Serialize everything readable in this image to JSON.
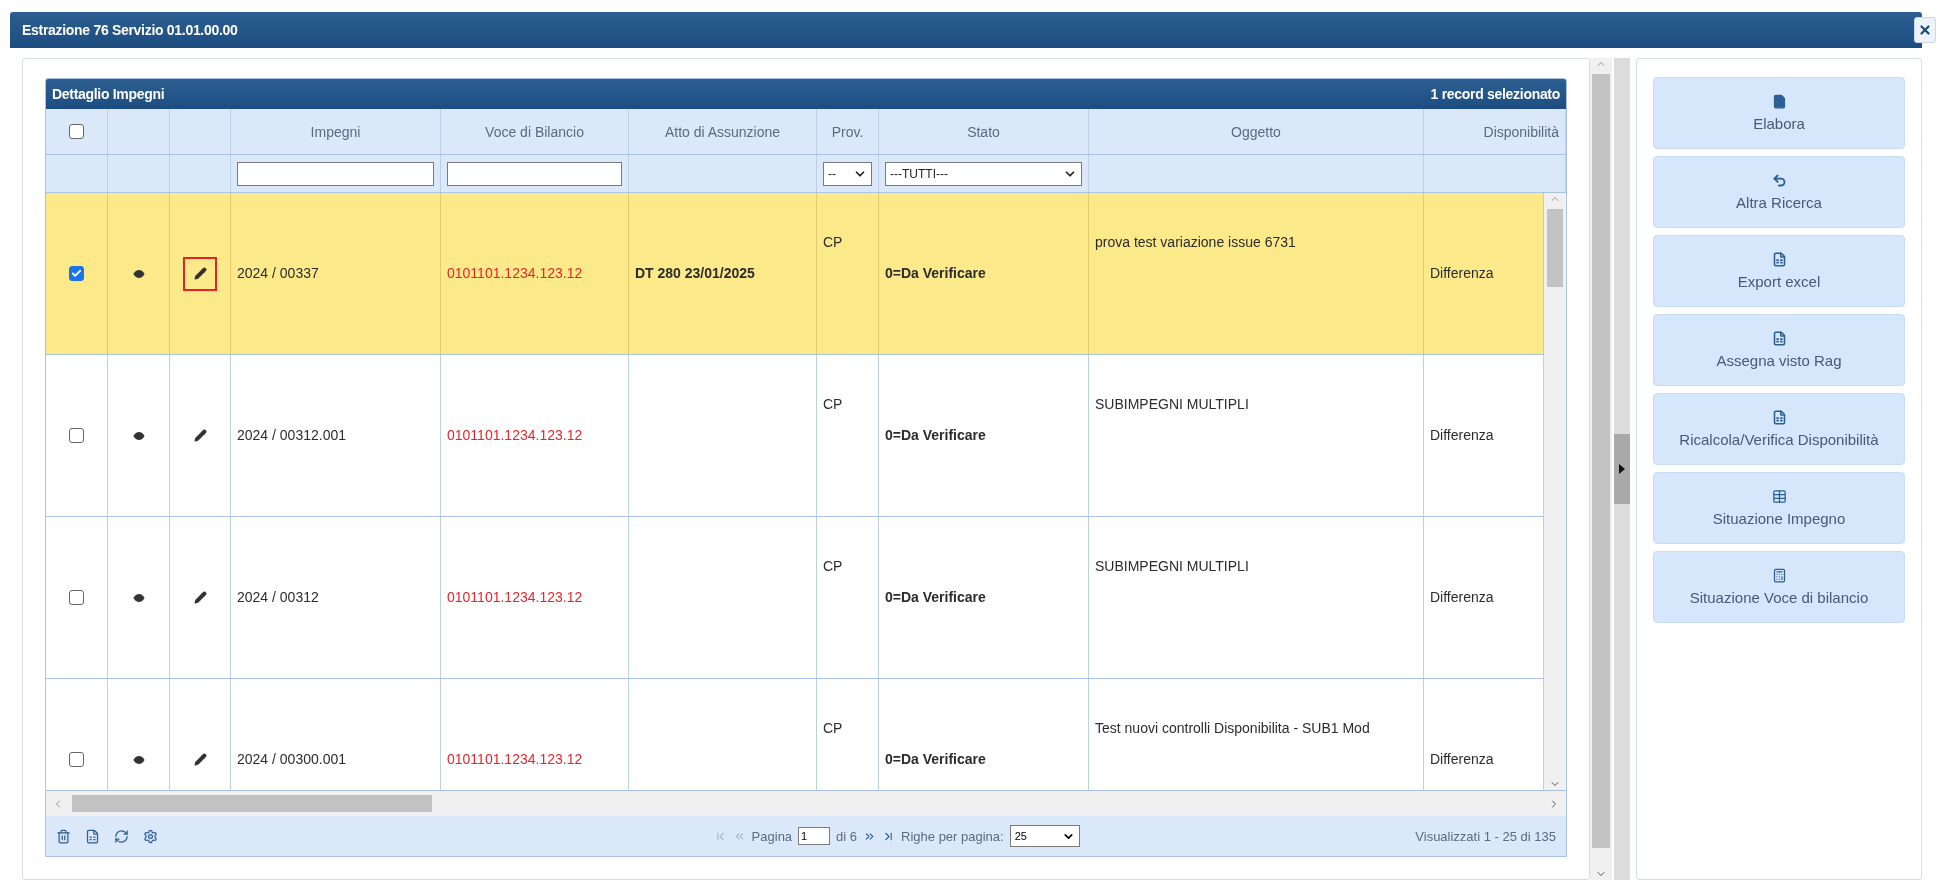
{
  "window": {
    "title": "Estrazione 76 Servizio 01.01.00.00"
  },
  "grid": {
    "title": "Dettaglio Impegni",
    "selection_info": "1 record selezionato",
    "all_checked": false,
    "columns": [
      {
        "label": "Impegni",
        "kind": "text"
      },
      {
        "label": "Voce di Bilancio",
        "kind": "text"
      },
      {
        "label": "Atto di Assunzione",
        "kind": "plain"
      },
      {
        "label": "Prov.",
        "kind": "select",
        "value": "--"
      },
      {
        "label": "Stato",
        "kind": "select",
        "value": "---TUTTI---"
      },
      {
        "label": "Oggetto",
        "kind": "plain"
      },
      {
        "label": "Disponibilità",
        "kind": "plain"
      }
    ],
    "rows": [
      {
        "selected": true,
        "checked": true,
        "edit_highlighted": true,
        "impegno": "2024 / 00337",
        "voce": "0101101.1234.123.12",
        "atto": "DT 280 23/01/2025",
        "prov": "CP",
        "stato": "0=Da Verificare",
        "oggetto": "prova test variazione issue 6731",
        "disponibilita": "Differenza"
      },
      {
        "selected": false,
        "checked": false,
        "edit_highlighted": false,
        "impegno": "2024 / 00312.001",
        "voce": "0101101.1234.123.12",
        "prov": "CP",
        "stato": "0=Da Verificare",
        "oggetto": "SUBIMPEGNI MULTIPLI",
        "disponibilita": "Differenza"
      },
      {
        "selected": false,
        "checked": false,
        "edit_highlighted": false,
        "impegno": "2024 / 00312",
        "voce": "0101101.1234.123.12",
        "prov": "CP",
        "stato": "0=Da Verificare",
        "oggetto": "SUBIMPEGNI MULTIPLI",
        "disponibilita": "Differenza"
      },
      {
        "selected": false,
        "checked": false,
        "edit_highlighted": false,
        "impegno": "2024 / 00300.001",
        "voce": "0101101.1234.123.12",
        "prov": "CP",
        "stato": "0=Da Verificare",
        "oggetto": "Test nuovi controlli Disponibilita - SUB1 Mod",
        "disponibilita": "Differenza"
      }
    ],
    "footer": {
      "page_label": "Pagina",
      "page": "1",
      "page_of": "di 6",
      "rows_label": "Righe per pagina:",
      "rows_per_page": "25",
      "summary": "Visualizzati 1 - 25 di 135"
    }
  },
  "actions": [
    {
      "label": "Elabora",
      "kind": "file"
    },
    {
      "label": "Altra Ricerca",
      "kind": "undo"
    },
    {
      "label": "Export excel",
      "kind": "sheet"
    },
    {
      "label": "Assegna visto Rag",
      "kind": "sheet"
    },
    {
      "label": "Ricalcola/Verifica Disponibilità",
      "kind": "sheet"
    },
    {
      "label": "Situazione Impegno",
      "kind": "table"
    },
    {
      "label": "Situazione Voce di bilancio",
      "kind": "calc"
    }
  ]
}
